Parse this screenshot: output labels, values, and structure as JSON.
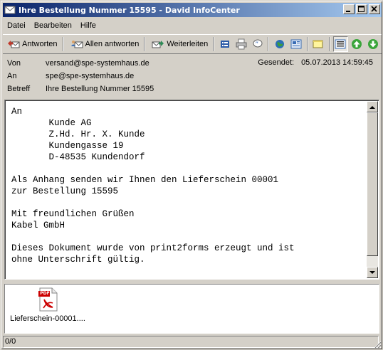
{
  "window": {
    "title": "Ihre Bestellung Nummer 15595 - David InfoCenter",
    "minimize": "_",
    "maximize": "□",
    "close": "✕"
  },
  "menu": {
    "items": [
      {
        "label": "Datei"
      },
      {
        "label": "Bearbeiten"
      },
      {
        "label": "Hilfe"
      }
    ]
  },
  "toolbar": {
    "reply_label": "Antworten",
    "reply_all_label": "Allen antworten",
    "forward_label": "Weiterleiten",
    "icons": [
      "properties-icon",
      "print-icon",
      "quote-icon",
      "globe-icon",
      "folder-view-icon",
      "note-icon",
      "header-toggle-icon",
      "previous-icon",
      "next-icon"
    ]
  },
  "header": {
    "from_label": "Von",
    "from_value": "versand@spe-systemhaus.de",
    "to_label": "An",
    "to_value": "spe@spe-systemhaus.de",
    "subject_label": "Betreff",
    "subject_value": "Ihre Bestellung Nummer 15595",
    "sent_label": "Gesendet:",
    "sent_value": "05.07.2013 14:59:45"
  },
  "body": {
    "text": "An\n       Kunde AG\n       Z.Hd. Hr. X. Kunde\n       Kundengasse 19\n       D-48535 Kundendorf\n\nAls Anhang senden wir Ihnen den Lieferschein 00001\nzur Bestellung 15595\n\nMit freundlichen Grüßen\nKabel GmbH\n\nDieses Dokument wurde von print2forms erzeugt und ist\nohne Unterschrift gültig."
  },
  "attachments": [
    {
      "label": "Lieferschein-00001....",
      "icon": "pdf-icon",
      "icon_text": "PDF"
    }
  ],
  "status": {
    "counter": "0/0"
  },
  "colors": {
    "title_start": "#0a246a",
    "title_end": "#a6caf0",
    "chrome": "#d4d0c8",
    "pdf_red": "#cc0000"
  }
}
